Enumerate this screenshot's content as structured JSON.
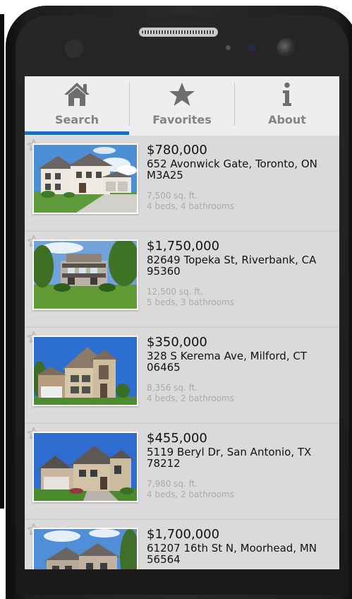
{
  "tabs": [
    {
      "label": "Search",
      "icon": "home-icon",
      "selected": true
    },
    {
      "label": "Favorites",
      "icon": "star-icon",
      "selected": false
    },
    {
      "label": "About",
      "icon": "info-icon",
      "selected": false
    }
  ],
  "listings": [
    {
      "price": "$780,000",
      "address": "652 Avonwick Gate, Toronto, ON M3A25",
      "sqft": "7,500 sq. ft.",
      "beds": "4 beds, 4 bathrooms"
    },
    {
      "price": "$1,750,000",
      "address": "82649 Topeka St, Riverbank, CA 95360",
      "sqft": "12,500 sq. ft.",
      "beds": "5 beds, 3 bathrooms"
    },
    {
      "price": "$350,000",
      "address": "328 S Kerema Ave, Milford, CT 06465",
      "sqft": "8,356 sq. ft.",
      "beds": "4 beds, 2 bathrooms"
    },
    {
      "price": "$455,000",
      "address": "5119 Beryl Dr, San Antonio, TX 78212",
      "sqft": "7,980 sq. ft.",
      "beds": "4 beds, 2 bathrooms"
    },
    {
      "price": "$1,700,000",
      "address": "61207 16th St N, Moorhead, MN 56564",
      "sqft": "",
      "beds": ""
    }
  ],
  "colors": {
    "accent": "#1b6cc4",
    "screen_bg": "#dadada",
    "tabbar_bg": "#eeeeee",
    "muted_text": "#a9a9a9"
  }
}
